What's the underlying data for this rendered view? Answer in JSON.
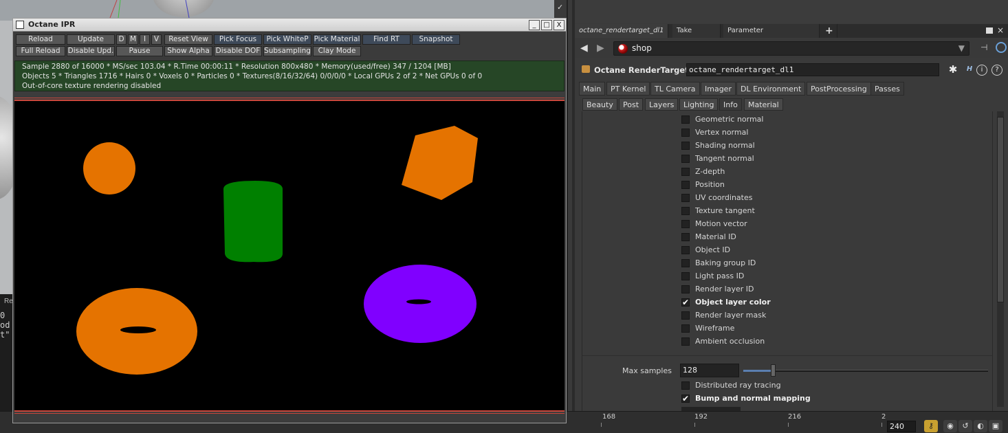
{
  "ipr": {
    "title": "Octane IPR",
    "window_buttons": [
      "_",
      "□",
      "X"
    ],
    "toolbar_row1": [
      {
        "label": "Reload"
      },
      {
        "label": "Update"
      },
      {
        "label": "D"
      },
      {
        "label": "M"
      },
      {
        "label": "I"
      },
      {
        "label": "V"
      },
      {
        "label": "Reset View"
      },
      {
        "label": "Pick Focus"
      },
      {
        "label": "Pick WhiteP"
      },
      {
        "label": "Pick Material"
      },
      {
        "label": "Find RT"
      },
      {
        "label": "Snapshot"
      }
    ],
    "toolbar_row2": [
      {
        "label": "Full Reload"
      },
      {
        "label": "Disable Upd."
      },
      {
        "label": "Pause"
      },
      {
        "label": "Show Alpha"
      },
      {
        "label": "Disable DOF"
      },
      {
        "label": "Subsampling"
      },
      {
        "label": "Clay Mode"
      }
    ],
    "status_lines": [
      "Sample 2880 of 16000 * MS/sec 103.04 * R.Time 00:00:11 * Resolution 800x480 * Memory(used/free) 347 / 1204 [MB]",
      "Objects 5 * Triangles 1716 * Hairs 0 * Voxels 0 * Particles 0 * Textures(8/16/32/64) 0/0/0/0 * Local GPUs 2 of 2 * Net GPUs 0 of 0",
      "Out-of-core texture rendering disabled"
    ],
    "render_colors": {
      "orange": "#e57300",
      "green": "#008000",
      "purple": "#8000ff",
      "background": "#000000"
    }
  },
  "console_text": [
    "Re",
    " 0",
    "od",
    "t\""
  ],
  "panel": {
    "tabs": [
      {
        "label": "octane_rendertarget_dl1",
        "active": true
      },
      {
        "label": "Take List"
      },
      {
        "label": "Parameter Spreadsheet"
      }
    ],
    "add_tab": "+",
    "path": "shop",
    "node_type": "Octane RenderTarget",
    "node_name": "octane_rendertarget_dl1",
    "main_tabs": [
      "Main",
      "PT Kernel",
      "TL Camera",
      "Imager",
      "DL Environment",
      "PostProcessing",
      "Passes"
    ],
    "sub_tabs": [
      "Beauty",
      "Post",
      "Layers",
      "Lighting",
      "Info",
      "Material"
    ],
    "active_sub_tab": "Info",
    "passes": [
      {
        "label": "Geometric normal",
        "checked": false
      },
      {
        "label": "Vertex normal",
        "checked": false
      },
      {
        "label": "Shading normal",
        "checked": false
      },
      {
        "label": "Tangent normal",
        "checked": false
      },
      {
        "label": "Z-depth",
        "checked": false
      },
      {
        "label": "Position",
        "checked": false
      },
      {
        "label": "UV coordinates",
        "checked": false
      },
      {
        "label": "Texture tangent",
        "checked": false
      },
      {
        "label": "Motion vector",
        "checked": false
      },
      {
        "label": "Material ID",
        "checked": false
      },
      {
        "label": "Object ID",
        "checked": false
      },
      {
        "label": "Baking group ID",
        "checked": false
      },
      {
        "label": "Light pass ID",
        "checked": false
      },
      {
        "label": "Render layer ID",
        "checked": false
      },
      {
        "label": "Object layer color",
        "checked": true
      },
      {
        "label": "Render layer mask",
        "checked": false
      },
      {
        "label": "Wireframe",
        "checked": false
      },
      {
        "label": "Ambient occlusion",
        "checked": false
      }
    ],
    "max_samples_label": "Max samples",
    "max_samples_value": "128",
    "max_samples_slider_fraction": 0.12,
    "extra_options": [
      {
        "label": "Distributed ray tracing",
        "checked": false
      },
      {
        "label": "Bump and normal mapping",
        "checked": true
      }
    ]
  },
  "timeline": {
    "ticks": [
      "168",
      "192",
      "216",
      "2"
    ],
    "current_frame": "240"
  }
}
